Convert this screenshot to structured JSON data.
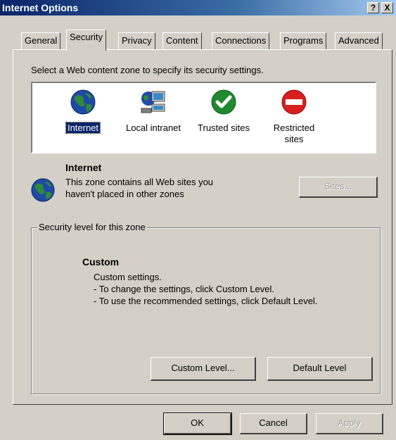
{
  "window": {
    "title": "Internet Options",
    "help_btn": "?",
    "close_btn": "X"
  },
  "tabs": [
    {
      "label": "General"
    },
    {
      "label": "Security"
    },
    {
      "label": "Privacy"
    },
    {
      "label": "Content"
    },
    {
      "label": "Connections"
    },
    {
      "label": "Programs"
    },
    {
      "label": "Advanced"
    }
  ],
  "security": {
    "prompt": "Select a Web content zone to specify its security settings.",
    "zones": [
      {
        "label": "Internet",
        "icon": "globe-icon",
        "selected": true
      },
      {
        "label": "Local intranet",
        "icon": "intranet-icon"
      },
      {
        "label": "Trusted sites",
        "icon": "checkmark-icon"
      },
      {
        "label": "Restricted sites",
        "icon": "no-entry-icon"
      }
    ],
    "zone_name": "Internet",
    "zone_desc_line1": "This zone contains all Web sites you",
    "zone_desc_line2": "haven't placed in other zones",
    "sites_button": "Sites...",
    "level_group_label": "Security level for this zone",
    "level_name": "Custom",
    "level_lines": [
      "Custom settings.",
      "- To change the settings, click Custom Level.",
      "- To use the recommended settings, click Default Level."
    ],
    "custom_level_button": "Custom Level...",
    "default_level_button": "Default Level"
  },
  "footer": {
    "ok": "OK",
    "cancel": "Cancel",
    "apply": "Apply"
  },
  "colors": {
    "face": "#d4d0c8",
    "title_start": "#0a246a",
    "selection": "#0a246a"
  }
}
